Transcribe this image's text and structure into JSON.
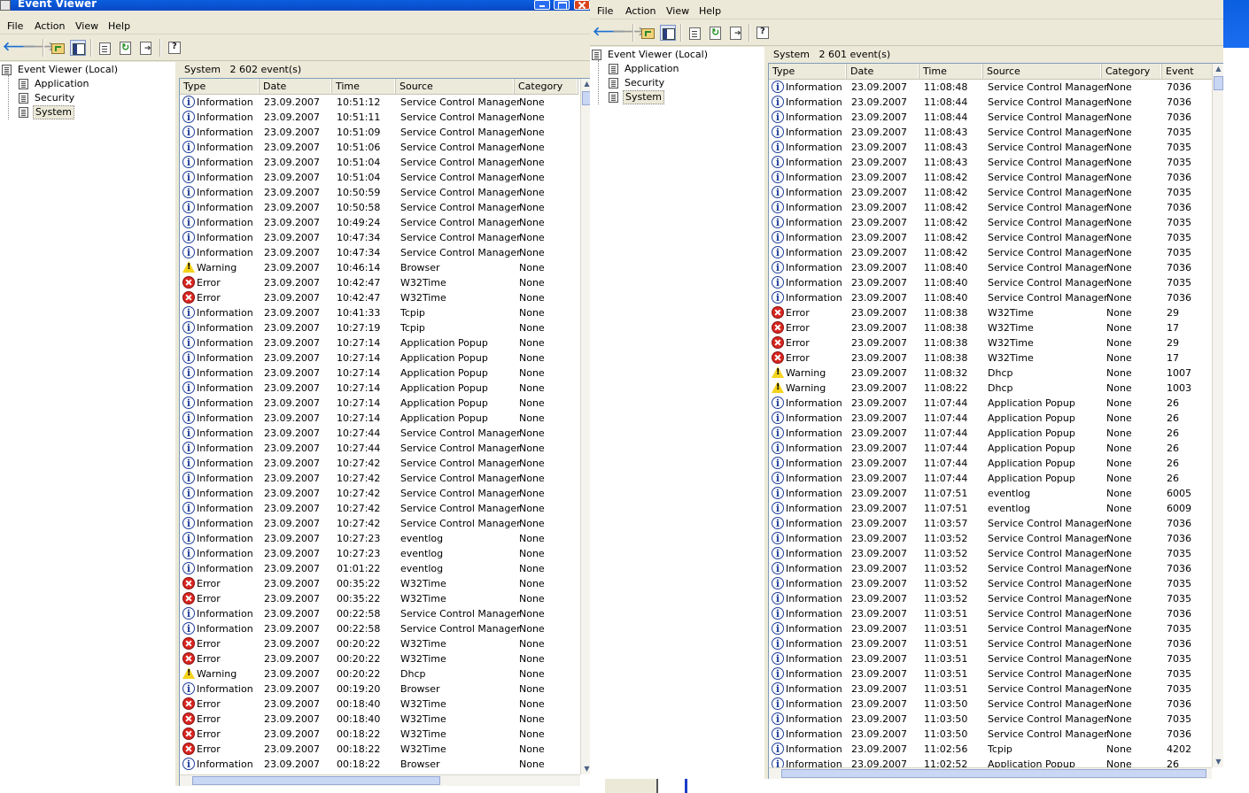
{
  "window1": {
    "title": "Event Viewer",
    "menu": [
      "File",
      "Action",
      "View",
      "Help"
    ],
    "tree": {
      "root": "Event Viewer (Local)",
      "items": [
        "Application",
        "Security",
        "System"
      ],
      "selected": "System"
    },
    "panel_title": "System",
    "event_count": "2 602 event(s)",
    "columns": [
      "Type",
      "Date",
      "Time",
      "Source",
      "Category"
    ],
    "rows": [
      [
        "Information",
        "23.09.2007",
        "10:51:12",
        "Service Control Manager",
        "None"
      ],
      [
        "Information",
        "23.09.2007",
        "10:51:11",
        "Service Control Manager",
        "None"
      ],
      [
        "Information",
        "23.09.2007",
        "10:51:09",
        "Service Control Manager",
        "None"
      ],
      [
        "Information",
        "23.09.2007",
        "10:51:06",
        "Service Control Manager",
        "None"
      ],
      [
        "Information",
        "23.09.2007",
        "10:51:04",
        "Service Control Manager",
        "None"
      ],
      [
        "Information",
        "23.09.2007",
        "10:51:04",
        "Service Control Manager",
        "None"
      ],
      [
        "Information",
        "23.09.2007",
        "10:50:59",
        "Service Control Manager",
        "None"
      ],
      [
        "Information",
        "23.09.2007",
        "10:50:58",
        "Service Control Manager",
        "None"
      ],
      [
        "Information",
        "23.09.2007",
        "10:49:24",
        "Service Control Manager",
        "None"
      ],
      [
        "Information",
        "23.09.2007",
        "10:47:34",
        "Service Control Manager",
        "None"
      ],
      [
        "Information",
        "23.09.2007",
        "10:47:34",
        "Service Control Manager",
        "None"
      ],
      [
        "Warning",
        "23.09.2007",
        "10:46:14",
        "Browser",
        "None"
      ],
      [
        "Error",
        "23.09.2007",
        "10:42:47",
        "W32Time",
        "None"
      ],
      [
        "Error",
        "23.09.2007",
        "10:42:47",
        "W32Time",
        "None"
      ],
      [
        "Information",
        "23.09.2007",
        "10:41:33",
        "Tcpip",
        "None"
      ],
      [
        "Information",
        "23.09.2007",
        "10:27:19",
        "Tcpip",
        "None"
      ],
      [
        "Information",
        "23.09.2007",
        "10:27:14",
        "Application Popup",
        "None"
      ],
      [
        "Information",
        "23.09.2007",
        "10:27:14",
        "Application Popup",
        "None"
      ],
      [
        "Information",
        "23.09.2007",
        "10:27:14",
        "Application Popup",
        "None"
      ],
      [
        "Information",
        "23.09.2007",
        "10:27:14",
        "Application Popup",
        "None"
      ],
      [
        "Information",
        "23.09.2007",
        "10:27:14",
        "Application Popup",
        "None"
      ],
      [
        "Information",
        "23.09.2007",
        "10:27:14",
        "Application Popup",
        "None"
      ],
      [
        "Information",
        "23.09.2007",
        "10:27:44",
        "Service Control Manager",
        "None"
      ],
      [
        "Information",
        "23.09.2007",
        "10:27:44",
        "Service Control Manager",
        "None"
      ],
      [
        "Information",
        "23.09.2007",
        "10:27:42",
        "Service Control Manager",
        "None"
      ],
      [
        "Information",
        "23.09.2007",
        "10:27:42",
        "Service Control Manager",
        "None"
      ],
      [
        "Information",
        "23.09.2007",
        "10:27:42",
        "Service Control Manager",
        "None"
      ],
      [
        "Information",
        "23.09.2007",
        "10:27:42",
        "Service Control Manager",
        "None"
      ],
      [
        "Information",
        "23.09.2007",
        "10:27:42",
        "Service Control Manager",
        "None"
      ],
      [
        "Information",
        "23.09.2007",
        "10:27:23",
        "eventlog",
        "None"
      ],
      [
        "Information",
        "23.09.2007",
        "10:27:23",
        "eventlog",
        "None"
      ],
      [
        "Information",
        "23.09.2007",
        "01:01:22",
        "eventlog",
        "None"
      ],
      [
        "Error",
        "23.09.2007",
        "00:35:22",
        "W32Time",
        "None"
      ],
      [
        "Error",
        "23.09.2007",
        "00:35:22",
        "W32Time",
        "None"
      ],
      [
        "Information",
        "23.09.2007",
        "00:22:58",
        "Service Control Manager",
        "None"
      ],
      [
        "Information",
        "23.09.2007",
        "00:22:58",
        "Service Control Manager",
        "None"
      ],
      [
        "Error",
        "23.09.2007",
        "00:20:22",
        "W32Time",
        "None"
      ],
      [
        "Error",
        "23.09.2007",
        "00:20:22",
        "W32Time",
        "None"
      ],
      [
        "Warning",
        "23.09.2007",
        "00:20:22",
        "Dhcp",
        "None"
      ],
      [
        "Information",
        "23.09.2007",
        "00:19:20",
        "Browser",
        "None"
      ],
      [
        "Error",
        "23.09.2007",
        "00:18:40",
        "W32Time",
        "None"
      ],
      [
        "Error",
        "23.09.2007",
        "00:18:40",
        "W32Time",
        "None"
      ],
      [
        "Error",
        "23.09.2007",
        "00:18:22",
        "W32Time",
        "None"
      ],
      [
        "Error",
        "23.09.2007",
        "00:18:22",
        "W32Time",
        "None"
      ],
      [
        "Information",
        "23.09.2007",
        "00:18:22",
        "Browser",
        "None"
      ]
    ]
  },
  "window2": {
    "menu": [
      "File",
      "Action",
      "View",
      "Help"
    ],
    "tree": {
      "root": "Event Viewer (Local)",
      "items": [
        "Application",
        "Security",
        "System"
      ],
      "selected": "System"
    },
    "panel_title": "System",
    "event_count": "2 601 event(s)",
    "columns": [
      "Type",
      "Date",
      "Time",
      "Source",
      "Category",
      "Event"
    ],
    "rows": [
      [
        "Information",
        "23.09.2007",
        "11:08:48",
        "Service Control Manager",
        "None",
        "7036"
      ],
      [
        "Information",
        "23.09.2007",
        "11:08:44",
        "Service Control Manager",
        "None",
        "7036"
      ],
      [
        "Information",
        "23.09.2007",
        "11:08:44",
        "Service Control Manager",
        "None",
        "7036"
      ],
      [
        "Information",
        "23.09.2007",
        "11:08:43",
        "Service Control Manager",
        "None",
        "7035"
      ],
      [
        "Information",
        "23.09.2007",
        "11:08:43",
        "Service Control Manager",
        "None",
        "7035"
      ],
      [
        "Information",
        "23.09.2007",
        "11:08:43",
        "Service Control Manager",
        "None",
        "7035"
      ],
      [
        "Information",
        "23.09.2007",
        "11:08:42",
        "Service Control Manager",
        "None",
        "7036"
      ],
      [
        "Information",
        "23.09.2007",
        "11:08:42",
        "Service Control Manager",
        "None",
        "7035"
      ],
      [
        "Information",
        "23.09.2007",
        "11:08:42",
        "Service Control Manager",
        "None",
        "7036"
      ],
      [
        "Information",
        "23.09.2007",
        "11:08:42",
        "Service Control Manager",
        "None",
        "7035"
      ],
      [
        "Information",
        "23.09.2007",
        "11:08:42",
        "Service Control Manager",
        "None",
        "7035"
      ],
      [
        "Information",
        "23.09.2007",
        "11:08:42",
        "Service Control Manager",
        "None",
        "7035"
      ],
      [
        "Information",
        "23.09.2007",
        "11:08:40",
        "Service Control Manager",
        "None",
        "7036"
      ],
      [
        "Information",
        "23.09.2007",
        "11:08:40",
        "Service Control Manager",
        "None",
        "7035"
      ],
      [
        "Information",
        "23.09.2007",
        "11:08:40",
        "Service Control Manager",
        "None",
        "7036"
      ],
      [
        "Error",
        "23.09.2007",
        "11:08:38",
        "W32Time",
        "None",
        "29"
      ],
      [
        "Error",
        "23.09.2007",
        "11:08:38",
        "W32Time",
        "None",
        "17"
      ],
      [
        "Error",
        "23.09.2007",
        "11:08:38",
        "W32Time",
        "None",
        "29"
      ],
      [
        "Error",
        "23.09.2007",
        "11:08:38",
        "W32Time",
        "None",
        "17"
      ],
      [
        "Warning",
        "23.09.2007",
        "11:08:32",
        "Dhcp",
        "None",
        "1007"
      ],
      [
        "Warning",
        "23.09.2007",
        "11:08:22",
        "Dhcp",
        "None",
        "1003"
      ],
      [
        "Information",
        "23.09.2007",
        "11:07:44",
        "Application Popup",
        "None",
        "26"
      ],
      [
        "Information",
        "23.09.2007",
        "11:07:44",
        "Application Popup",
        "None",
        "26"
      ],
      [
        "Information",
        "23.09.2007",
        "11:07:44",
        "Application Popup",
        "None",
        "26"
      ],
      [
        "Information",
        "23.09.2007",
        "11:07:44",
        "Application Popup",
        "None",
        "26"
      ],
      [
        "Information",
        "23.09.2007",
        "11:07:44",
        "Application Popup",
        "None",
        "26"
      ],
      [
        "Information",
        "23.09.2007",
        "11:07:44",
        "Application Popup",
        "None",
        "26"
      ],
      [
        "Information",
        "23.09.2007",
        "11:07:51",
        "eventlog",
        "None",
        "6005"
      ],
      [
        "Information",
        "23.09.2007",
        "11:07:51",
        "eventlog",
        "None",
        "6009"
      ],
      [
        "Information",
        "23.09.2007",
        "11:03:57",
        "Service Control Manager",
        "None",
        "7036"
      ],
      [
        "Information",
        "23.09.2007",
        "11:03:52",
        "Service Control Manager",
        "None",
        "7036"
      ],
      [
        "Information",
        "23.09.2007",
        "11:03:52",
        "Service Control Manager",
        "None",
        "7035"
      ],
      [
        "Information",
        "23.09.2007",
        "11:03:52",
        "Service Control Manager",
        "None",
        "7036"
      ],
      [
        "Information",
        "23.09.2007",
        "11:03:52",
        "Service Control Manager",
        "None",
        "7035"
      ],
      [
        "Information",
        "23.09.2007",
        "11:03:52",
        "Service Control Manager",
        "None",
        "7035"
      ],
      [
        "Information",
        "23.09.2007",
        "11:03:51",
        "Service Control Manager",
        "None",
        "7036"
      ],
      [
        "Information",
        "23.09.2007",
        "11:03:51",
        "Service Control Manager",
        "None",
        "7035"
      ],
      [
        "Information",
        "23.09.2007",
        "11:03:51",
        "Service Control Manager",
        "None",
        "7036"
      ],
      [
        "Information",
        "23.09.2007",
        "11:03:51",
        "Service Control Manager",
        "None",
        "7035"
      ],
      [
        "Information",
        "23.09.2007",
        "11:03:51",
        "Service Control Manager",
        "None",
        "7035"
      ],
      [
        "Information",
        "23.09.2007",
        "11:03:51",
        "Service Control Manager",
        "None",
        "7035"
      ],
      [
        "Information",
        "23.09.2007",
        "11:03:50",
        "Service Control Manager",
        "None",
        "7036"
      ],
      [
        "Information",
        "23.09.2007",
        "11:03:50",
        "Service Control Manager",
        "None",
        "7035"
      ],
      [
        "Information",
        "23.09.2007",
        "11:03:50",
        "Service Control Manager",
        "None",
        "7036"
      ],
      [
        "Information",
        "23.09.2007",
        "11:02:56",
        "Tcpip",
        "None",
        "4202"
      ],
      [
        "Information",
        "23.09.2007",
        "11:02:52",
        "Application Popup",
        "None",
        "26"
      ]
    ]
  },
  "colors": {
    "titlebar": "#0a5fe0",
    "chrome": "#ece9d8",
    "error": "#d8261f",
    "warning": "#f5d31c",
    "info": "#1f3f9a"
  },
  "icons": {
    "back": "back-arrow-icon",
    "forward": "forward-arrow-icon",
    "up": "up-folder-icon",
    "tree_toggle": "show-hide-tree-icon",
    "properties": "properties-icon",
    "refresh": "refresh-icon",
    "export": "export-list-icon",
    "help": "help-icon"
  }
}
